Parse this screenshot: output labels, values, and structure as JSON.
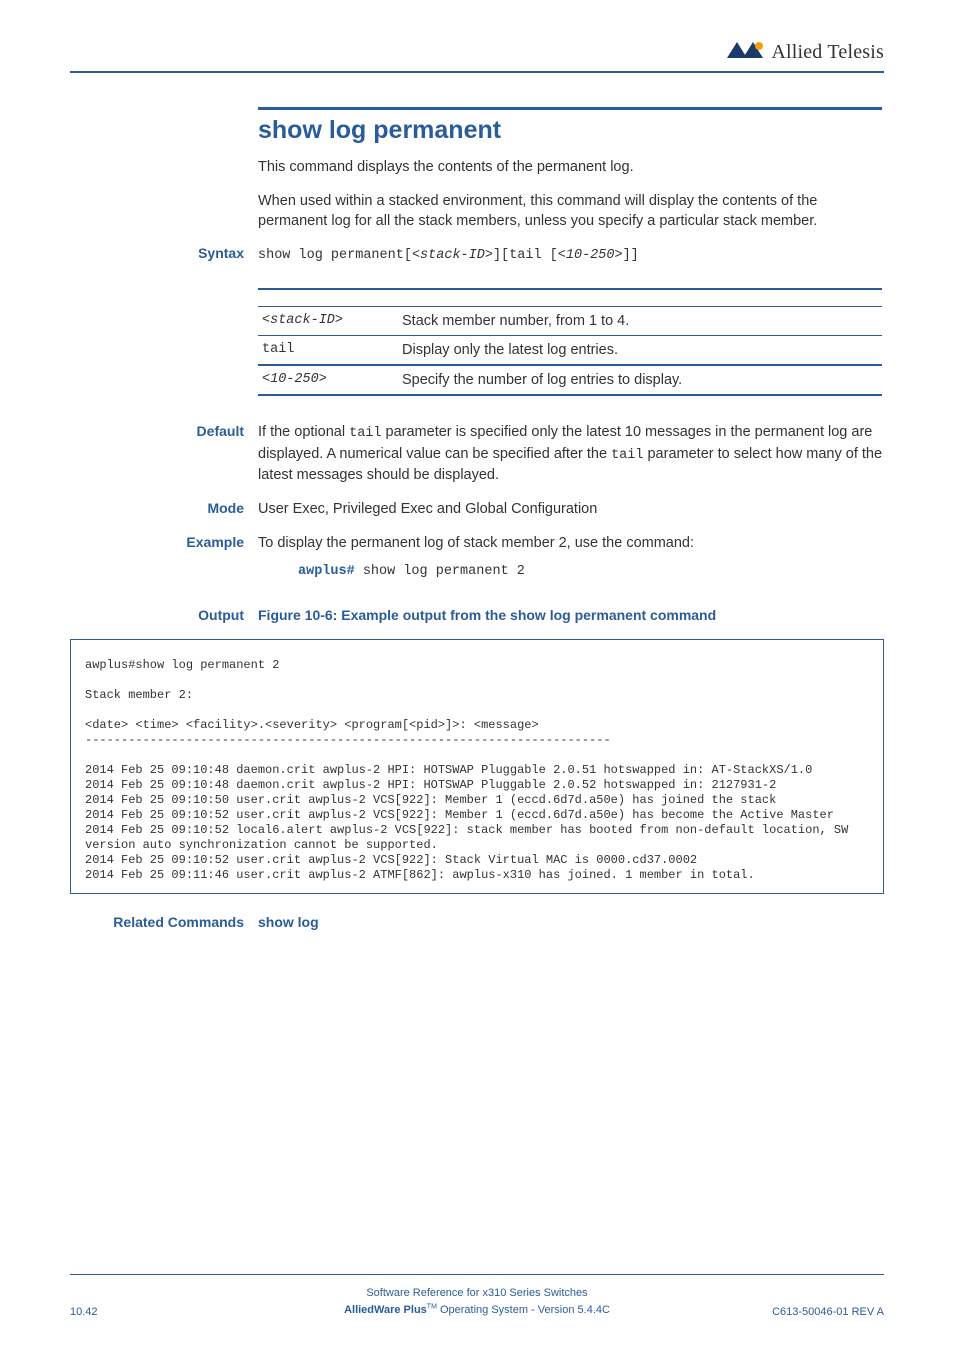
{
  "header": {
    "brand_text": "Allied Telesis"
  },
  "title": "show log permanent",
  "intro1": "This command displays the contents of the permanent log.",
  "intro2": "When used within a stacked environment, this command will display the contents of the permanent log for all the stack members, unless you specify a particular stack member.",
  "labels": {
    "syntax": "Syntax",
    "default": "Default",
    "mode": "Mode",
    "example": "Example",
    "output": "Output",
    "related": "Related Commands"
  },
  "syntax": {
    "prefix": "show log permanent[",
    "stack_id": "<stack-ID>",
    "mid": "][tail [",
    "range": "<10-250>",
    "suffix": "]]"
  },
  "params": [
    {
      "param": "<stack-ID>",
      "italic": true,
      "desc": "Stack member number, from 1 to 4."
    },
    {
      "param": "tail",
      "italic": false,
      "desc": "Display only the latest log entries."
    },
    {
      "param": "<10-250>",
      "italic": true,
      "desc": "Specify the number of log entries to display."
    }
  ],
  "default_text": {
    "pre": "If the optional ",
    "code1": "tail",
    "mid": " parameter is specified only the latest 10 messages in the permanent log are displayed. A numerical value can be specified after the ",
    "code2": "tail",
    "post": " parameter to select how many of the latest messages should be displayed."
  },
  "mode_text": "User Exec, Privileged Exec and Global Configuration",
  "example_text": "To display the permanent log of stack member 2, use the command:",
  "example_cmd": {
    "prompt": "awplus#",
    "cmd": " show log permanent 2"
  },
  "output_caption": "Figure 10-6: Example output from the show log permanent command",
  "output_block": "awplus#show log permanent 2\n\nStack member 2:\n\n<date> <time> <facility>.<severity> <program[<pid>]>: <message>\n-------------------------------------------------------------------------\n\n2014 Feb 25 09:10:48 daemon.crit awplus-2 HPI: HOTSWAP Pluggable 2.0.51 hotswapped in: AT-StackXS/1.0\n2014 Feb 25 09:10:48 daemon.crit awplus-2 HPI: HOTSWAP Pluggable 2.0.52 hotswapped in: 2127931-2\n2014 Feb 25 09:10:50 user.crit awplus-2 VCS[922]: Member 1 (eccd.6d7d.a50e) has joined the stack\n2014 Feb 25 09:10:52 user.crit awplus-2 VCS[922]: Member 1 (eccd.6d7d.a50e) has become the Active Master\n2014 Feb 25 09:10:52 local6.alert awplus-2 VCS[922]: stack member has booted from non-default location, SW version auto synchronization cannot be supported.\n2014 Feb 25 09:10:52 user.crit awplus-2 VCS[922]: Stack Virtual MAC is 0000.cd37.0002\n2014 Feb 25 09:11:46 user.crit awplus-2 ATMF[862]: awplus-x310 has joined. 1 member in total.\n",
  "related_link": "show log",
  "footer": {
    "page": "10.42",
    "line1": "Software Reference for x310 Series Switches",
    "line2_a": "AlliedWare Plus",
    "line2_tm": "TM",
    "line2_b": " Operating System  - Version 5.4.4C",
    "rev": "C613-50046-01 REV A"
  }
}
